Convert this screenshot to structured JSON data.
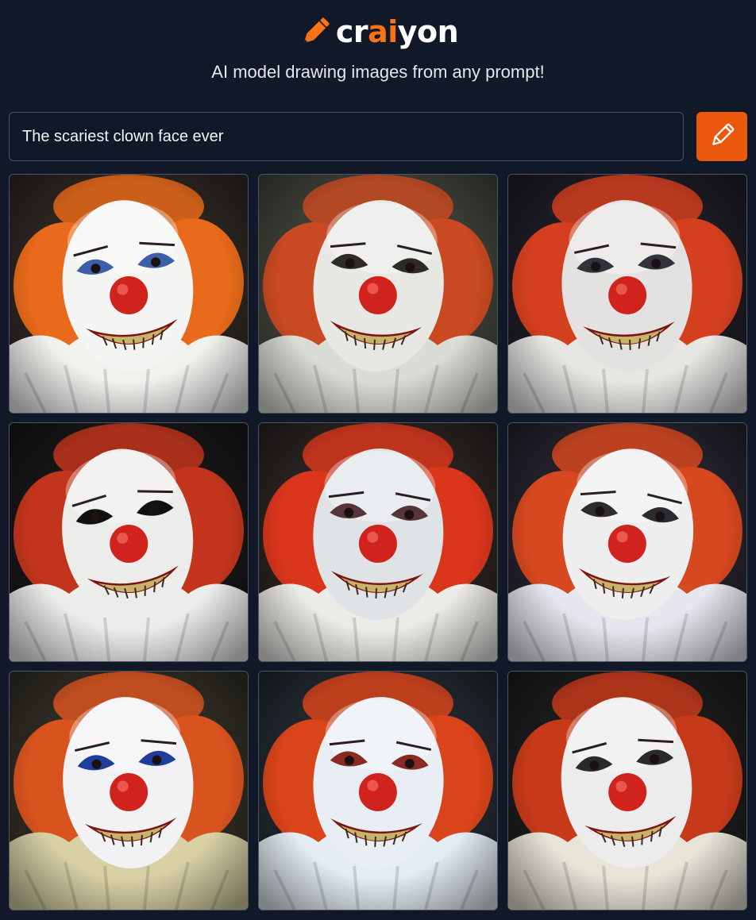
{
  "brand": {
    "name_prefix": "cr",
    "name_highlight": "ai",
    "name_suffix": "yon",
    "icon": "pencil-icon",
    "accent_color": "#f97316"
  },
  "tagline": "AI model drawing images from any prompt!",
  "prompt": {
    "value": "The scariest clown face ever",
    "button_icon": "pencil-icon",
    "button_color": "#ea580c"
  },
  "results": {
    "count": 9,
    "images": [
      {
        "hair": "#e86a1a",
        "ruff": "#f1f1ee",
        "face": "#f4f4f2",
        "bg": "#2a2420",
        "eye": "#3b5fa8",
        "collar2": "#f1f1ee"
      },
      {
        "hair": "#c94a22",
        "ruff": "#d9ddd6",
        "face": "#e7e8e3",
        "bg": "#3a3d35",
        "eye": "#2e2a26",
        "collar2": "#cfd5cd"
      },
      {
        "hair": "#d4401f",
        "ruff": "#e8e6e3",
        "face": "#e4e2e0",
        "bg": "#1c1a22",
        "eye": "#32323a",
        "collar2": "#3651a8"
      },
      {
        "hair": "#c2351c",
        "ruff": "#ececea",
        "face": "#ececea",
        "bg": "#151515",
        "eye": "#111111",
        "collar2": "#e0dcd8"
      },
      {
        "hair": "#d9361c",
        "ruff": "#ecebe7",
        "face": "#dfe3e6",
        "bg": "#27211f",
        "eye": "#55343a",
        "collar2": "#c8c0b5"
      },
      {
        "hair": "#d6481f",
        "ruff": "#e6e7ee",
        "face": "#eeeeee",
        "bg": "#22202a",
        "eye": "#2b2b30",
        "collar2": "#3a3f8a"
      },
      {
        "hair": "#d9531f",
        "ruff": "#d8d1a6",
        "face": "#f2f2f4",
        "bg": "#2d2a22",
        "eye": "#1f3d9a",
        "collar2": "#5b2fa6"
      },
      {
        "hair": "#d9441a",
        "ruff": "#e4ecf4",
        "face": "#e9eef4",
        "bg": "#1f262c",
        "eye": "#8a2a22",
        "collar2": "#c8d4e0"
      },
      {
        "hair": "#c63a1a",
        "ruff": "#e8e4d8",
        "face": "#ececec",
        "bg": "#1a1a1a",
        "eye": "#2a2a2a",
        "collar2": "#d9c233"
      }
    ]
  }
}
